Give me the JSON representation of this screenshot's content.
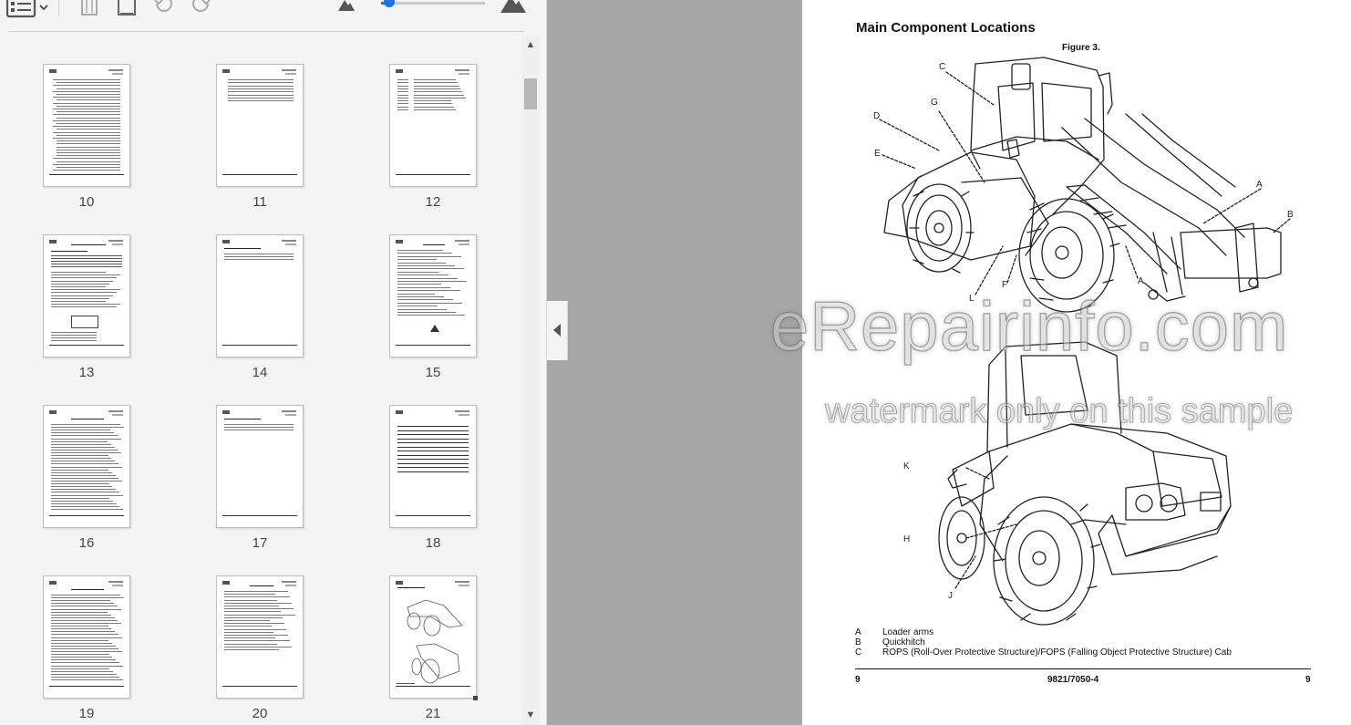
{
  "toolbar": {
    "icons": [
      "thumbnail-view-icon",
      "trash-icon",
      "insert-page-icon",
      "rotate-left-icon",
      "rotate-right-icon",
      "small-mountain-icon",
      "large-mountain-icon"
    ],
    "zoom_level": 0.04
  },
  "thumbnails": [
    {
      "page": "10",
      "kind": "toc-dense"
    },
    {
      "page": "11",
      "kind": "toc-short"
    },
    {
      "page": "12",
      "kind": "list-short"
    },
    {
      "page": "13",
      "kind": "text-table"
    },
    {
      "page": "14",
      "kind": "text-minimal"
    },
    {
      "page": "15",
      "kind": "text-sparse"
    },
    {
      "page": "16",
      "kind": "text-dense"
    },
    {
      "page": "17",
      "kind": "text-minimal"
    },
    {
      "page": "18",
      "kind": "ruled-lines"
    },
    {
      "page": "19",
      "kind": "text-dense"
    },
    {
      "page": "20",
      "kind": "text-medium"
    },
    {
      "page": "21",
      "kind": "figure"
    }
  ],
  "scrollbar": {
    "position": 0.06
  },
  "document": {
    "title": "Main Component Locations",
    "figure_caption": "Figure 3.",
    "callouts": [
      {
        "id": "C"
      },
      {
        "id": "G"
      },
      {
        "id": "D"
      },
      {
        "id": "E"
      },
      {
        "id": "A"
      },
      {
        "id": "B"
      },
      {
        "id": "F"
      },
      {
        "id": "A"
      },
      {
        "id": "L"
      },
      {
        "id": "K"
      },
      {
        "id": "H"
      },
      {
        "id": "J"
      }
    ],
    "legend": [
      {
        "letter": "A",
        "desc": "Loader arms"
      },
      {
        "letter": "B",
        "desc": "Quickhitch"
      },
      {
        "letter": "C",
        "desc": "ROPS (Roll-Over Protective Structure)/FOPS (Falling Object Protective Structure) Cab"
      }
    ],
    "footer": {
      "left": "9",
      "center": "9821/7050-4",
      "right": "9"
    }
  },
  "watermark": {
    "line1": "eRepairinfo.com",
    "line2": "watermark only on this sample"
  },
  "colors": {
    "accent": "#1a73e8",
    "panel_bg": "#f4f4f4",
    "gutter": "#a6a6a6"
  }
}
